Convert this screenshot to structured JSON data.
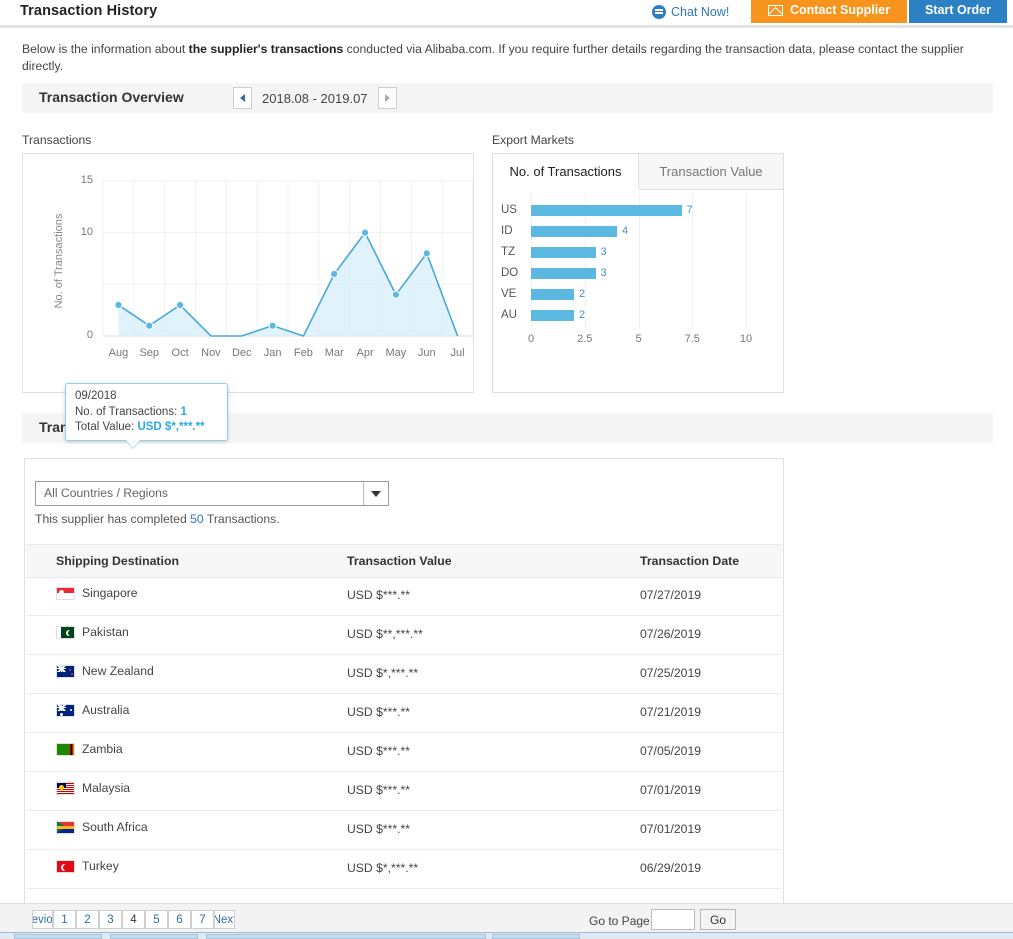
{
  "header": {
    "title": "Transaction History",
    "chat_label": "Chat Now!",
    "contact_label": "Contact Supplier",
    "start_order_label": "Start Order"
  },
  "intro": {
    "part1": "Below is the information about ",
    "bold": "the supplier's transactions",
    "part2": " conducted via Alibaba.com. If you require further details regarding the transaction data, please contact the supplier directly."
  },
  "overview": {
    "title": "Transaction Overview",
    "date_range": "2018.08 - 2019.07",
    "prev_icon": "caret-left-icon",
    "next_icon": "caret-right-icon"
  },
  "panels": {
    "transactions_label": "Transactions",
    "export_markets_label": "Export Markets"
  },
  "tooltip": {
    "date": "09/2018",
    "count_label": "No. of Transactions:",
    "count_value": "1",
    "total_label": "Total Value:",
    "total_value": "USD $*,***.**"
  },
  "bar_tabs": {
    "active": "No. of Transactions",
    "idle": "Transaction Value"
  },
  "details": {
    "title": "Transaction Details",
    "filter_value": "All Countries / Regions",
    "completed_prefix": "This supplier has completed ",
    "completed_count": "50",
    "completed_suffix": " Transactions.",
    "columns": [
      "Shipping Destination",
      "Transaction Value",
      "Transaction Date"
    ],
    "rows": [
      {
        "country": "Singapore",
        "flag": "sg",
        "value": "USD $***.**",
        "date": "07/27/2019"
      },
      {
        "country": "Pakistan",
        "flag": "pk",
        "value": "USD $**,***.**",
        "date": "07/26/2019"
      },
      {
        "country": "New Zealand",
        "flag": "nz",
        "value": "USD $*,***.**",
        "date": "07/25/2019"
      },
      {
        "country": "Australia",
        "flag": "au",
        "value": "USD $***.**",
        "date": "07/21/2019"
      },
      {
        "country": "Zambia",
        "flag": "zm",
        "value": "USD $***.**",
        "date": "07/05/2019"
      },
      {
        "country": "Malaysia",
        "flag": "my",
        "value": "USD $***.**",
        "date": "07/01/2019"
      },
      {
        "country": "South Africa",
        "flag": "za",
        "value": "USD $***.**",
        "date": "07/01/2019"
      },
      {
        "country": "Turkey",
        "flag": "tr",
        "value": "USD $*,***.**",
        "date": "06/29/2019"
      }
    ]
  },
  "pagination": {
    "prev_label": "Previous",
    "next_label": "Next",
    "pages": [
      "1",
      "2",
      "3",
      "4",
      "5",
      "6",
      "7"
    ],
    "current": "4",
    "goto_label": "Go to Page",
    "goto_value": "",
    "go_label": "Go"
  },
  "colors": {
    "accent_blue": "#5bb8e0",
    "link_blue": "#2f79bc",
    "orange": "#f7941e",
    "button_blue": "#2c80c4"
  },
  "chart_data": [
    {
      "type": "line",
      "title": "Transactions",
      "xlabel": "",
      "ylabel": "No. of Transactions",
      "categories": [
        "Aug",
        "Sep",
        "Oct",
        "Nov",
        "Dec",
        "Jan",
        "Feb",
        "Mar",
        "Apr",
        "May",
        "Jun",
        "Jul"
      ],
      "values": [
        3,
        1,
        3,
        0,
        0,
        1,
        0,
        6,
        10,
        4,
        8,
        0
      ],
      "ylim": [
        0,
        15
      ],
      "yticks": [
        0,
        5,
        10,
        15
      ],
      "grid": true,
      "area_fill": true
    },
    {
      "type": "bar",
      "title": "Export Markets",
      "orientation": "horizontal",
      "xlabel": "",
      "ylabel": "",
      "categories": [
        "US",
        "ID",
        "TZ",
        "DO",
        "VE",
        "AU"
      ],
      "values": [
        7,
        4,
        3,
        3,
        2,
        2
      ],
      "xlim": [
        0,
        10
      ],
      "xticks": [
        0,
        2.5,
        5,
        7.5,
        10
      ],
      "grid": true,
      "datalabels": [
        "7",
        "4",
        "3",
        "3",
        "2",
        "2"
      ]
    }
  ]
}
